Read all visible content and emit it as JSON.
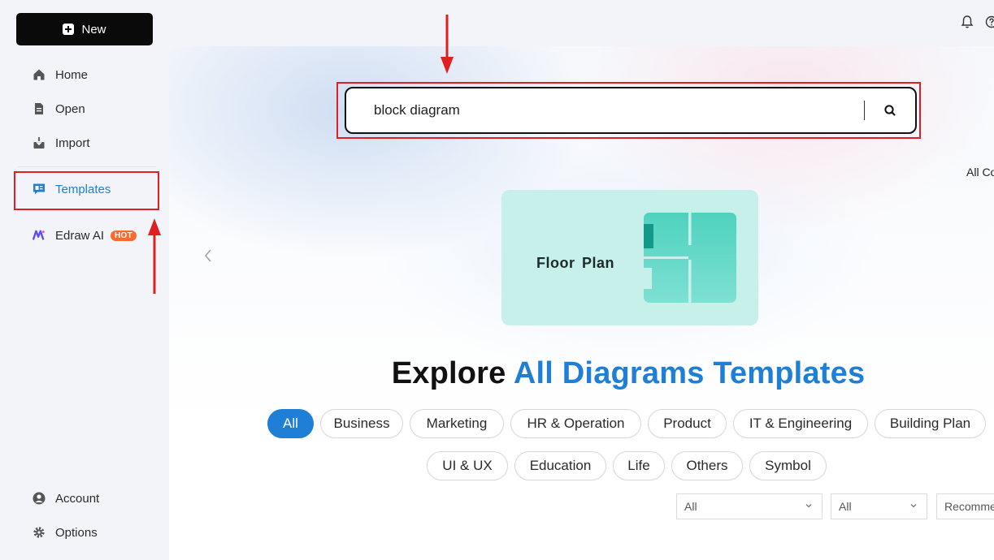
{
  "sidebar": {
    "new_label": "New",
    "items": [
      {
        "label": "Home",
        "icon": "home-icon"
      },
      {
        "label": "Open",
        "icon": "file-icon"
      },
      {
        "label": "Import",
        "icon": "import-icon"
      },
      {
        "label": "Templates",
        "icon": "templates-icon"
      },
      {
        "label": "Edraw AI",
        "icon": "edraw-ai-icon",
        "badge": "HOT"
      }
    ],
    "bottom": [
      {
        "label": "Account",
        "icon": "account-icon"
      },
      {
        "label": "Options",
        "icon": "gear-icon"
      }
    ]
  },
  "search": {
    "value": "block diagram"
  },
  "all_categories_label": "All Co",
  "banner": {
    "title": "Floor Plan"
  },
  "headline": {
    "prefix": "Explore",
    "accent": "All Diagrams Templates"
  },
  "chips_row1": [
    "All",
    "Business",
    "Marketing",
    "HR & Operation",
    "Product",
    "IT & Engineering",
    "Building Plan"
  ],
  "chips_row2": [
    "UI & UX",
    "Education",
    "Life",
    "Others",
    "Symbol"
  ],
  "filters": {
    "select1": "All",
    "select2": "All",
    "select3": "Recomme"
  },
  "colors": {
    "accent": "#1f7fd6",
    "annotation_red": "#e02020",
    "hot_badge": "#ff6a2c"
  }
}
